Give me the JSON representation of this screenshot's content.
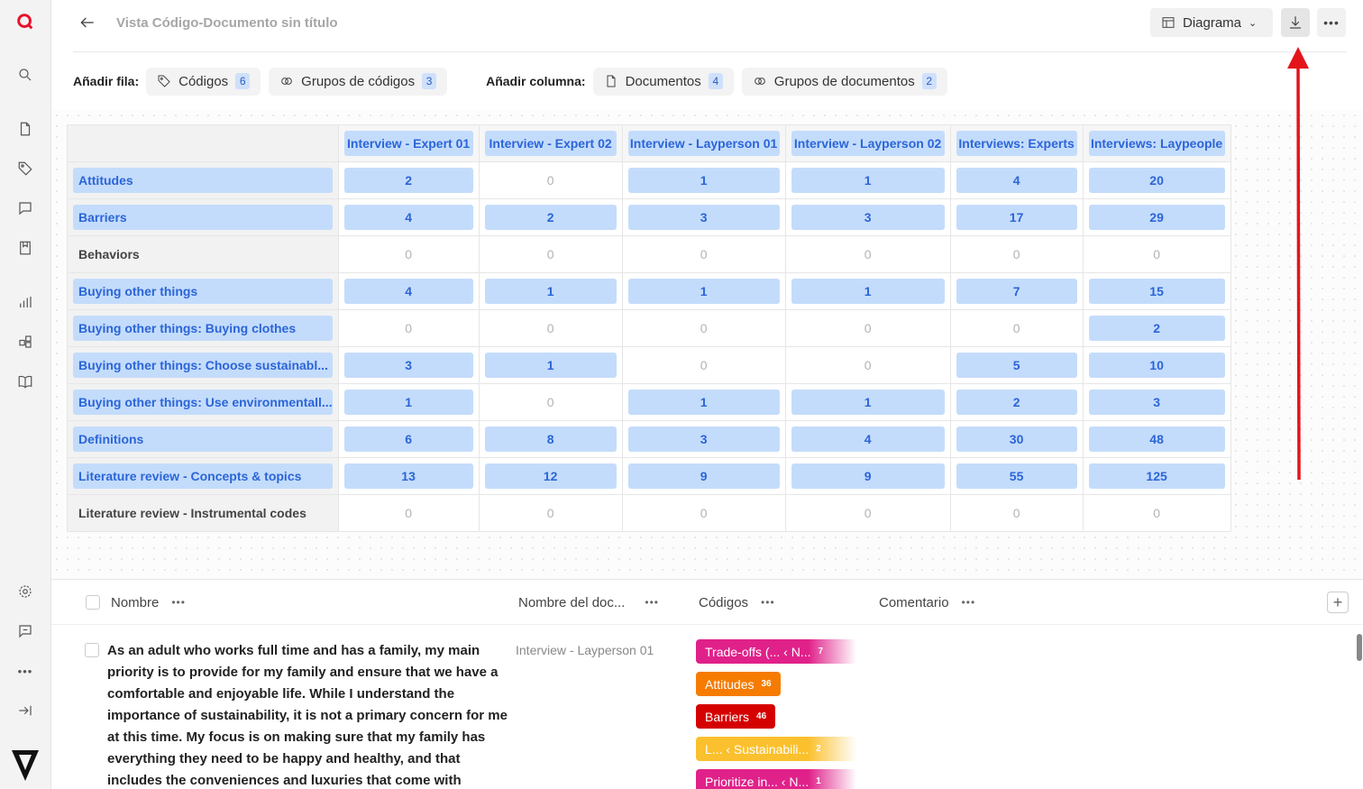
{
  "header": {
    "title": "Vista Código-Documento sin título",
    "view_button": "Diagrama"
  },
  "addbar": {
    "add_row_label": "Añadir fila:",
    "codes_label": "Códigos",
    "codes_count": "6",
    "code_groups_label": "Grupos de códigos",
    "code_groups_count": "3",
    "add_col_label": "Añadir columna:",
    "docs_label": "Documentos",
    "docs_count": "4",
    "doc_groups_label": "Grupos de documentos",
    "doc_groups_count": "2"
  },
  "matrix": {
    "columns": [
      "Interview - Expert 01",
      "Interview - Expert 02",
      "Interview - Layperson 01",
      "Interview - Layperson 02",
      "Interviews: Experts",
      "Interviews: Laypeople"
    ],
    "rows": [
      {
        "label": "Attitudes",
        "highlight": true,
        "values": [
          "2",
          "0",
          "1",
          "1",
          "4",
          "20"
        ]
      },
      {
        "label": "Barriers",
        "highlight": true,
        "values": [
          "4",
          "2",
          "3",
          "3",
          "17",
          "29"
        ]
      },
      {
        "label": "Behaviors",
        "highlight": false,
        "values": [
          "0",
          "0",
          "0",
          "0",
          "0",
          "0"
        ]
      },
      {
        "label": "Buying other things",
        "highlight": true,
        "values": [
          "4",
          "1",
          "1",
          "1",
          "7",
          "15"
        ]
      },
      {
        "label": "Buying other things: Buying clothes",
        "highlight": true,
        "values": [
          "0",
          "0",
          "0",
          "0",
          "0",
          "2"
        ]
      },
      {
        "label": "Buying other things: Choose sustainabl...",
        "highlight": true,
        "values": [
          "3",
          "1",
          "0",
          "0",
          "5",
          "10"
        ]
      },
      {
        "label": "Buying other things: Use environmentall...",
        "highlight": true,
        "values": [
          "1",
          "0",
          "1",
          "1",
          "2",
          "3"
        ]
      },
      {
        "label": "Definitions",
        "highlight": true,
        "values": [
          "6",
          "8",
          "3",
          "4",
          "30",
          "48"
        ]
      },
      {
        "label": "Literature review - Concepts & topics",
        "highlight": true,
        "values": [
          "13",
          "12",
          "9",
          "9",
          "55",
          "125"
        ]
      },
      {
        "label": "Literature review - Instrumental codes",
        "highlight": false,
        "values": [
          "0",
          "0",
          "0",
          "0",
          "0",
          "0"
        ]
      }
    ]
  },
  "list": {
    "col_name": "Nombre",
    "col_doc": "Nombre del doc...",
    "col_codes": "Códigos",
    "col_comment": "Comentario",
    "quote": "As an adult who works full time and has a family, my main priority is to provide for my family and ensure that we have a comfortable and enjoyable life. While I understand the importance of sustainability, it is not a primary concern for me at this time. My focus is on making sure that my family has everything they need to be happy and healthy, and that includes the conveniences and luxuries that come with modern living.",
    "doc_name": "Interview - Layperson 01",
    "tags": [
      {
        "label": "Trade-offs (...  ‹  N...",
        "count": "7",
        "color": "#e0218a"
      },
      {
        "label": "Attitudes",
        "count": "36",
        "color": "#f57c00"
      },
      {
        "label": "Barriers",
        "count": "46",
        "color": "#d50000"
      },
      {
        "label": "L...  ‹  Sustainabili...",
        "count": "2",
        "color": "#fbc02d"
      },
      {
        "label": "Prioritize in...  ‹  N...",
        "count": "1",
        "color": "#e0218a"
      }
    ]
  }
}
